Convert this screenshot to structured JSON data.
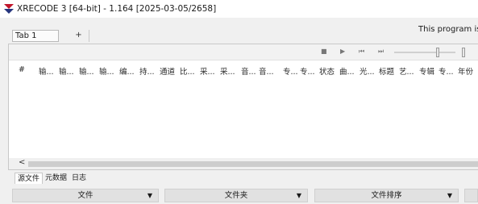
{
  "window": {
    "title": "XRECODE 3 [64-bit] - 1.164 [2025-03-05/2658]",
    "accent_red": "#c0152b",
    "accent_blue": "#25347d"
  },
  "tabs": {
    "active": "Tab 1",
    "add": "+"
  },
  "notice": "This program is n",
  "player": {
    "stop": "■",
    "play": "▶",
    "prev": "⏮",
    "next": "⏭"
  },
  "columns": [
    "#",
    "输...",
    "输...",
    "输...",
    "输...",
    "编...",
    "持...",
    "通道",
    "比...",
    "采...",
    "采...",
    "音...",
    "音...",
    "专...",
    "专...",
    "状态",
    "曲...",
    "光...",
    "标题",
    "艺...",
    "专辑",
    "专...",
    "年份"
  ],
  "scroll": {
    "left_arrow": "<"
  },
  "bottom_tabs": [
    "源文件",
    "元数据",
    "日志"
  ],
  "footer": {
    "combo1": "文件",
    "combo2": "文件夹",
    "combo3": "文件排序",
    "arrow": "▼"
  }
}
